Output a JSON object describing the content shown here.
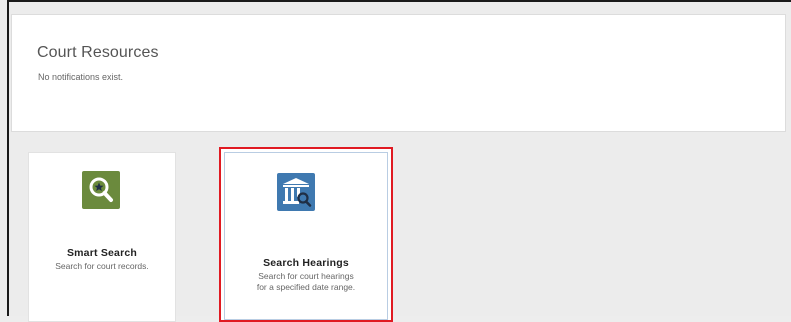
{
  "resources": {
    "title": "Court Resources",
    "notification": "No notifications exist."
  },
  "tiles": [
    {
      "name": "Smart Search",
      "description_lines": [
        "Search for court records."
      ],
      "icon": "magnifier-star-icon",
      "color": "#6b8a3d",
      "highlighted": false
    },
    {
      "name": "Search Hearings",
      "description_lines": [
        "Search for court hearings",
        "for a specified date range."
      ],
      "icon": "courthouse-search-icon",
      "color": "#3f79b0",
      "highlighted": true,
      "highlight_color": "#e01a22"
    }
  ]
}
